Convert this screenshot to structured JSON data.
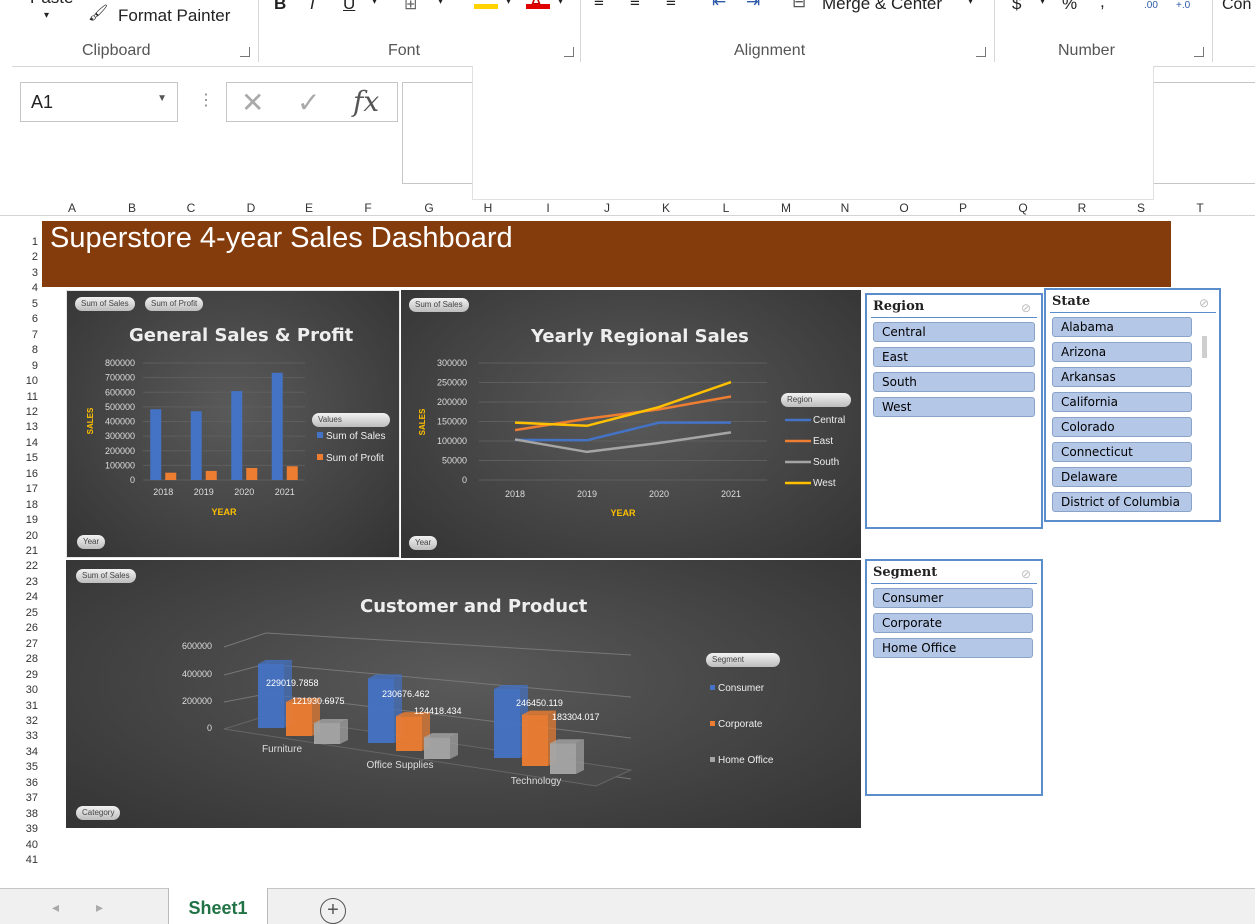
{
  "ribbon": {
    "paste": "Paste",
    "format_painter": "Format Painter",
    "bold": "B",
    "italic": "I",
    "underline": "U",
    "merge_center": "Merge & Center",
    "currency": "$",
    "percent": "%",
    "comma": ",",
    "inc_decimal": ".00",
    "dec_decimal": "+.0",
    "cond_format": "Con Forn",
    "groups": {
      "clipboard": "Clipboard",
      "font": "Font",
      "alignment": "Alignment",
      "number": "Number"
    }
  },
  "formula_bar": {
    "name_box": "A1",
    "cancel": "✕",
    "enter": "✓",
    "fx": "fx",
    "value": ""
  },
  "columns": [
    "A",
    "B",
    "C",
    "D",
    "E",
    "F",
    "G",
    "H",
    "I",
    "J",
    "K",
    "L",
    "M",
    "N",
    "O",
    "P",
    "Q",
    "R",
    "S",
    "T"
  ],
  "rows": [
    "1",
    "2",
    "3",
    "4",
    "5",
    "6",
    "7",
    "8",
    "9",
    "10",
    "11",
    "12",
    "13",
    "14",
    "15",
    "16",
    "17",
    "18",
    "19",
    "20",
    "21",
    "22",
    "23",
    "24",
    "25",
    "26",
    "27",
    "28",
    "29",
    "30",
    "31",
    "32",
    "33",
    "34",
    "35",
    "36",
    "37",
    "38",
    "39",
    "40",
    "41"
  ],
  "dashboard_title": "Superstore 4-year Sales Dashboard",
  "chart_data": [
    {
      "type": "bar",
      "title": "General Sales & Profit",
      "xlabel": "YEAR",
      "ylabel": "SALES",
      "categories": [
        "2018",
        "2019",
        "2020",
        "2021"
      ],
      "series": [
        {
          "name": "Sum of Sales",
          "values": [
            484000,
            470000,
            608000,
            733000
          ],
          "color": "#4472c4"
        },
        {
          "name": "Sum of Profit",
          "values": [
            50000,
            62000,
            82000,
            94000
          ],
          "color": "#ed7d31"
        }
      ],
      "ylim": [
        0,
        800000
      ],
      "yticks": [
        "800000",
        "700000",
        "600000",
        "500000",
        "400000",
        "300000",
        "200000",
        "100000",
        "0"
      ],
      "legend_title": "Values",
      "field_buttons": [
        "Sum of Sales",
        "Sum of Profit",
        "Year"
      ]
    },
    {
      "type": "line",
      "title": "Yearly Regional Sales",
      "xlabel": "YEAR",
      "ylabel": "SALES",
      "categories": [
        "2018",
        "2019",
        "2020",
        "2021"
      ],
      "series": [
        {
          "name": "Central",
          "values": [
            103000,
            102000,
            147000,
            147000
          ],
          "color": "#4472c4"
        },
        {
          "name": "East",
          "values": [
            128000,
            157000,
            181000,
            214000
          ],
          "color": "#ed7d31"
        },
        {
          "name": "South",
          "values": [
            104000,
            72000,
            95000,
            122000
          ],
          "color": "#a5a5a5"
        },
        {
          "name": "West",
          "values": [
            147000,
            139000,
            187000,
            251000
          ],
          "color": "#ffc000"
        }
      ],
      "ylim": [
        0,
        300000
      ],
      "yticks": [
        "300000",
        "250000",
        "200000",
        "150000",
        "100000",
        "50000",
        "0"
      ],
      "legend_title": "Region",
      "field_buttons": [
        "Sum of Sales",
        "Year"
      ]
    },
    {
      "type": "bar",
      "title": "Customer and Product",
      "categories": [
        "Furniture",
        "Office Supplies",
        "Technology"
      ],
      "series": [
        {
          "name": "Consumer",
          "values": [
            229019.7858,
            230676.462,
            246450.119
          ],
          "color": "#4472c4"
        },
        {
          "name": "Corporate",
          "values": [
            121930.6975,
            124418.434,
            183304.017
          ],
          "color": "#ed7d31"
        },
        {
          "name": "Home Office",
          "values": [
            75000,
            78000,
            110000
          ],
          "color": "#a5a5a5"
        }
      ],
      "data_labels": [
        "229019.7858",
        "121930.6975",
        "230676.462",
        "124418.434",
        "246450.119",
        "183304.017"
      ],
      "ylim": [
        0,
        600000
      ],
      "yticks": [
        "600000",
        "400000",
        "200000",
        "0"
      ],
      "legend_title": "Segment",
      "field_buttons": [
        "Sum of Sales",
        "Category"
      ]
    }
  ],
  "slicers": {
    "region": {
      "header": "Region",
      "items": [
        "Central",
        "East",
        "South",
        "West"
      ]
    },
    "state": {
      "header": "State",
      "items": [
        "Alabama",
        "Arizona",
        "Arkansas",
        "California",
        "Colorado",
        "Connecticut",
        "Delaware",
        "District of Columbia"
      ]
    },
    "segment": {
      "header": "Segment",
      "items": [
        "Consumer",
        "Corporate",
        "Home Office"
      ]
    }
  },
  "sheet_tabs": {
    "active": "Sheet1",
    "add": "+"
  }
}
